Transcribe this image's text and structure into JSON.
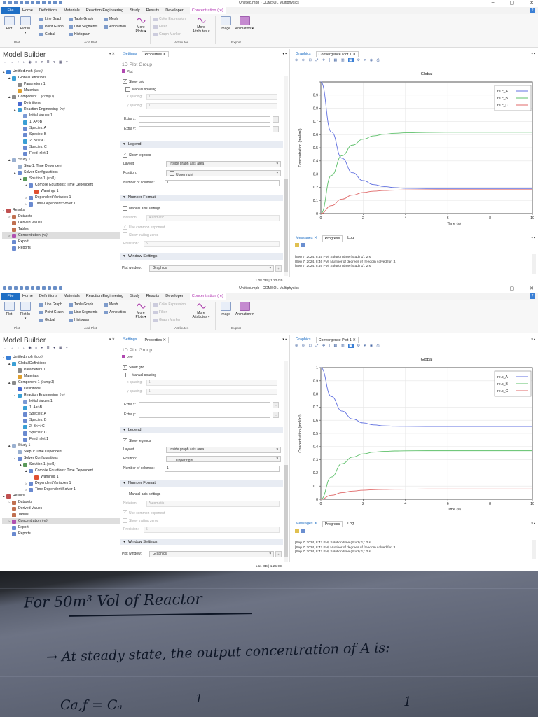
{
  "windows": [
    {
      "title": "Untitled.mph - COMSOL Multiphysics",
      "memory": "1.08 GB | 1.22 GB",
      "messages": [
        "[Sep 7, 2024, 8:45 PM] Solution time (Study 1): 2 s.",
        "[Sep 7, 2024, 8:46 PM] Number of degrees of freedom solved for: 3.",
        "[Sep 7, 2024, 8:46 PM] Solution time (Study 1): 2 s."
      ],
      "chart_data": {
        "type": "line",
        "title": "Global",
        "xlabel": "Time (s)",
        "ylabel": "Concentration (mol/m³)",
        "xlim": [
          0,
          10
        ],
        "ylim": [
          0,
          1
        ],
        "x_ticks": [
          "0",
          "2",
          "4",
          "6",
          "8",
          "10"
        ],
        "y_ticks": [
          "0",
          "0.1",
          "0.2",
          "0.3",
          "0.4",
          "0.5",
          "0.6",
          "0.7",
          "0.8",
          "0.9",
          "1"
        ],
        "legend_position": "top-right",
        "series": [
          {
            "name": "re.c_A",
            "color": "#6070e0",
            "x": [
              0,
              0.5,
              1,
              1.5,
              2,
              2.5,
              3,
              3.5,
              4,
              5,
              6,
              7,
              8,
              9,
              10
            ],
            "y": [
              1.0,
              0.62,
              0.42,
              0.31,
              0.25,
              0.22,
              0.205,
              0.197,
              0.192,
              0.19,
              0.19,
              0.19,
              0.19,
              0.19,
              0.19
            ]
          },
          {
            "name": "re.c_B",
            "color": "#5ec06a",
            "x": [
              0,
              0.5,
              1,
              1.5,
              2,
              2.5,
              3,
              3.5,
              4,
              5,
              6,
              7,
              8,
              9,
              10
            ],
            "y": [
              0,
              0.29,
              0.44,
              0.52,
              0.565,
              0.59,
              0.603,
              0.61,
              0.614,
              0.617,
              0.618,
              0.618,
              0.618,
              0.618,
              0.618
            ]
          },
          {
            "name": "re.c_C",
            "color": "#e06a6a",
            "x": [
              0,
              0.5,
              1,
              1.5,
              2,
              2.5,
              3,
              3.5,
              4,
              5,
              6,
              7,
              8,
              9,
              10
            ],
            "y": [
              0,
              0.06,
              0.11,
              0.14,
              0.16,
              0.17,
              0.175,
              0.178,
              0.18,
              0.181,
              0.182,
              0.182,
              0.182,
              0.182,
              0.182
            ]
          }
        ]
      }
    },
    {
      "title": "Untitled.mph - COMSOL Multiphysics",
      "memory": "1.11 GB | 1.25 GB",
      "messages": [
        "[Sep 7, 2024, 8:47 PM] Solution time (Study 1): 2 s.",
        "[Sep 7, 2024, 8:47 PM] Number of degrees of freedom solved for: 3.",
        "[Sep 7, 2024, 8:47 PM] Solution time (Study 1): 2 s."
      ],
      "chart_data": {
        "type": "line",
        "title": "Global",
        "xlabel": "Time (s)",
        "ylabel": "Concentration (mol/m³)",
        "xlim": [
          0,
          10
        ],
        "ylim": [
          0,
          1
        ],
        "x_ticks": [
          "0",
          "2",
          "4",
          "6",
          "8",
          "10"
        ],
        "y_ticks": [
          "0",
          "0.1",
          "0.2",
          "0.3",
          "0.4",
          "0.5",
          "0.6",
          "0.7",
          "0.8",
          "0.9",
          "1"
        ],
        "legend_position": "top-right",
        "series": [
          {
            "name": "re.c_A",
            "color": "#6070e0",
            "x": [
              0,
              0.5,
              1,
              1.5,
              2,
              2.5,
              3,
              3.5,
              4,
              5,
              6,
              7,
              8,
              9,
              10
            ],
            "y": [
              1.0,
              0.78,
              0.67,
              0.61,
              0.58,
              0.565,
              0.558,
              0.555,
              0.554,
              0.553,
              0.553,
              0.553,
              0.553,
              0.553,
              0.553
            ]
          },
          {
            "name": "re.c_B",
            "color": "#5ec06a",
            "x": [
              0,
              0.5,
              1,
              1.5,
              2,
              2.5,
              3,
              3.5,
              4,
              5,
              6,
              7,
              8,
              9,
              10
            ],
            "y": [
              0,
              0.17,
              0.27,
              0.32,
              0.345,
              0.358,
              0.364,
              0.367,
              0.368,
              0.369,
              0.369,
              0.369,
              0.369,
              0.369,
              0.369
            ]
          },
          {
            "name": "re.c_C",
            "color": "#e06a6a",
            "x": [
              0,
              0.5,
              1,
              1.5,
              2,
              2.5,
              3,
              3.5,
              4,
              5,
              6,
              7,
              8,
              9,
              10
            ],
            "y": [
              0,
              0.03,
              0.05,
              0.062,
              0.069,
              0.073,
              0.075,
              0.076,
              0.077,
              0.078,
              0.078,
              0.078,
              0.078,
              0.078,
              0.078
            ]
          }
        ]
      }
    }
  ],
  "menu": {
    "file": "File",
    "tabs": [
      "Home",
      "Definitions",
      "Materials",
      "Reaction Engineering",
      "Study",
      "Results",
      "Developer",
      "Concentration (re)"
    ]
  },
  "ribbon": {
    "plot": "Plot",
    "plot_in": "Plot In",
    "line_graph": "Line Graph",
    "point_graph": "Point Graph",
    "global": "Global",
    "table_graph": "Table Graph",
    "line_segments": "Line Segments",
    "histogram": "Histogram",
    "mesh": "Mesh",
    "annotation": "Annotation",
    "more_plots": "More Plots",
    "color_expression": "Color Expression",
    "filter": "Filter",
    "graph_marker": "Graph Marker",
    "more_attributes": "More Attributes",
    "image": "Image",
    "animation": "Animation",
    "group_plot": "Plot",
    "group_add_plot": "Add Plot",
    "group_attributes": "Attributes",
    "group_export": "Export"
  },
  "model_builder": {
    "title": "Model Builder",
    "tree": [
      {
        "label": "Untitled.mph",
        "tag": "(root)",
        "lv": 0,
        "arr": "▲",
        "icon": "#3a7fd5"
      },
      {
        "label": "Global Definitions",
        "tag": "",
        "lv": 1,
        "arr": "▲",
        "icon": "#3a9fd5"
      },
      {
        "label": "Parameters 1",
        "tag": "",
        "lv": 2,
        "arr": "",
        "icon": "#8a8a8a"
      },
      {
        "label": "Materials",
        "tag": "",
        "lv": 2,
        "arr": "",
        "icon": "#e0a030"
      },
      {
        "label": "Component 1",
        "tag": "(comp1)",
        "lv": 1,
        "arr": "▲",
        "icon": "#8a8a8a"
      },
      {
        "label": "Definitions",
        "tag": "",
        "lv": 2,
        "arr": "",
        "icon": "#4a6ad0"
      },
      {
        "label": "Reaction Engineering",
        "tag": "(re)",
        "lv": 2,
        "arr": "▲",
        "icon": "#3a9fd5"
      },
      {
        "label": "Initial Values 1",
        "tag": "",
        "lv": 3,
        "arr": "",
        "icon": "#7a9ad5"
      },
      {
        "label": "1: A=>B",
        "tag": "",
        "lv": 3,
        "arr": "",
        "icon": "#3a9fd5"
      },
      {
        "label": "Species: A",
        "tag": "",
        "lv": 3,
        "arr": "",
        "icon": "#6a8ad0"
      },
      {
        "label": "Species: B",
        "tag": "",
        "lv": 3,
        "arr": "",
        "icon": "#6a8ad0"
      },
      {
        "label": "2: B<=>C",
        "tag": "",
        "lv": 3,
        "arr": "",
        "icon": "#3a9fd5"
      },
      {
        "label": "Species: C",
        "tag": "",
        "lv": 3,
        "arr": "",
        "icon": "#6a8ad0"
      },
      {
        "label": "Feed Inlet 1",
        "tag": "",
        "lv": 3,
        "arr": "",
        "icon": "#6a8ad0"
      },
      {
        "label": "Study 1",
        "tag": "",
        "lv": 1,
        "arr": "▲",
        "icon": "#9ab0d0"
      },
      {
        "label": "Step 1: Time Dependent",
        "tag": "",
        "lv": 2,
        "arr": "",
        "icon": "#9ab0d0"
      },
      {
        "label": "Solver Configurations",
        "tag": "",
        "lv": 2,
        "arr": "▲",
        "icon": "#6a8ad0"
      },
      {
        "label": "Solution 1",
        "tag": "(sol1)",
        "lv": 3,
        "arr": "▲",
        "icon": "#5a9a5a"
      },
      {
        "label": "Compile Equations: Time Dependent",
        "tag": "",
        "lv": 4,
        "arr": "▲",
        "icon": "#6a8ad0"
      },
      {
        "label": "Warnings 1",
        "tag": "",
        "lv": 5,
        "arr": "",
        "icon": "#e05030"
      },
      {
        "label": "Dependent Variables 1",
        "tag": "",
        "lv": 4,
        "arr": "▷",
        "icon": "#6a8ad0"
      },
      {
        "label": "Time-Dependent Solver 1",
        "tag": "",
        "lv": 4,
        "arr": "▷",
        "icon": "#6a8ad0"
      },
      {
        "label": "Results",
        "tag": "",
        "lv": 0,
        "arr": "▲",
        "icon": "#c05050"
      },
      {
        "label": "Datasets",
        "tag": "",
        "lv": 1,
        "arr": "▷",
        "icon": "#c07050"
      },
      {
        "label": "Derived Values",
        "tag": "",
        "lv": 1,
        "arr": "",
        "icon": "#c07050"
      },
      {
        "label": "Tables",
        "tag": "",
        "lv": 1,
        "arr": "",
        "icon": "#c07050"
      },
      {
        "label": "Concentration",
        "tag": "(re)",
        "lv": 1,
        "arr": "▷",
        "icon": "#b050b0",
        "sel": true
      },
      {
        "label": "Export",
        "tag": "",
        "lv": 1,
        "arr": "",
        "icon": "#6a8ad0"
      },
      {
        "label": "Reports",
        "tag": "",
        "lv": 1,
        "arr": "",
        "icon": "#6a8ad0"
      }
    ]
  },
  "settings": {
    "tab_settings": "Settings",
    "tab_properties": "Properties",
    "heading": "1D Plot Group",
    "sub": "Plot",
    "show_grid": "Show grid",
    "manual_spacing": "Manual spacing",
    "x_spacing_label": "x spacing:",
    "x_spacing_value": "1",
    "y_spacing_label": "y spacing:",
    "y_spacing_value": "1",
    "extra_x_label": "Extra x:",
    "extra_y_label": "Extra y:",
    "legend_section": "Legend",
    "show_legends": "Show legends",
    "layout_label": "Layout:",
    "layout_value": "Inside graph axis area",
    "position_label": "Position:",
    "position_value": "Upper right",
    "columns_label": "Number of columns:",
    "columns_value": "1",
    "number_format_section": "Number Format",
    "manual_axis": "Manual axis settings",
    "notation_label": "Notation:",
    "notation_value": "Automatic",
    "common_exponent": "Use common exponent",
    "trailing_zeros": "Show trailing zeros",
    "precision_label": "Precision:",
    "precision_value": "5",
    "window_section": "Window Settings",
    "plot_window_label": "Plot window:",
    "plot_window_value": "Graphics"
  },
  "graphics": {
    "tab_graphics": "Graphics",
    "tab_convergence": "Convergence Plot 1"
  },
  "messages_panel": {
    "tab_messages": "Messages",
    "tab_progress": "Progress",
    "tab_log": "Log"
  },
  "note": {
    "line1": "For 50m³ Vol of Reactor",
    "line2": "→ At steady state, the output concentration of A is:",
    "frag1": "1",
    "frag2": "1",
    "frag3": "Ca,f = Cₐ"
  }
}
